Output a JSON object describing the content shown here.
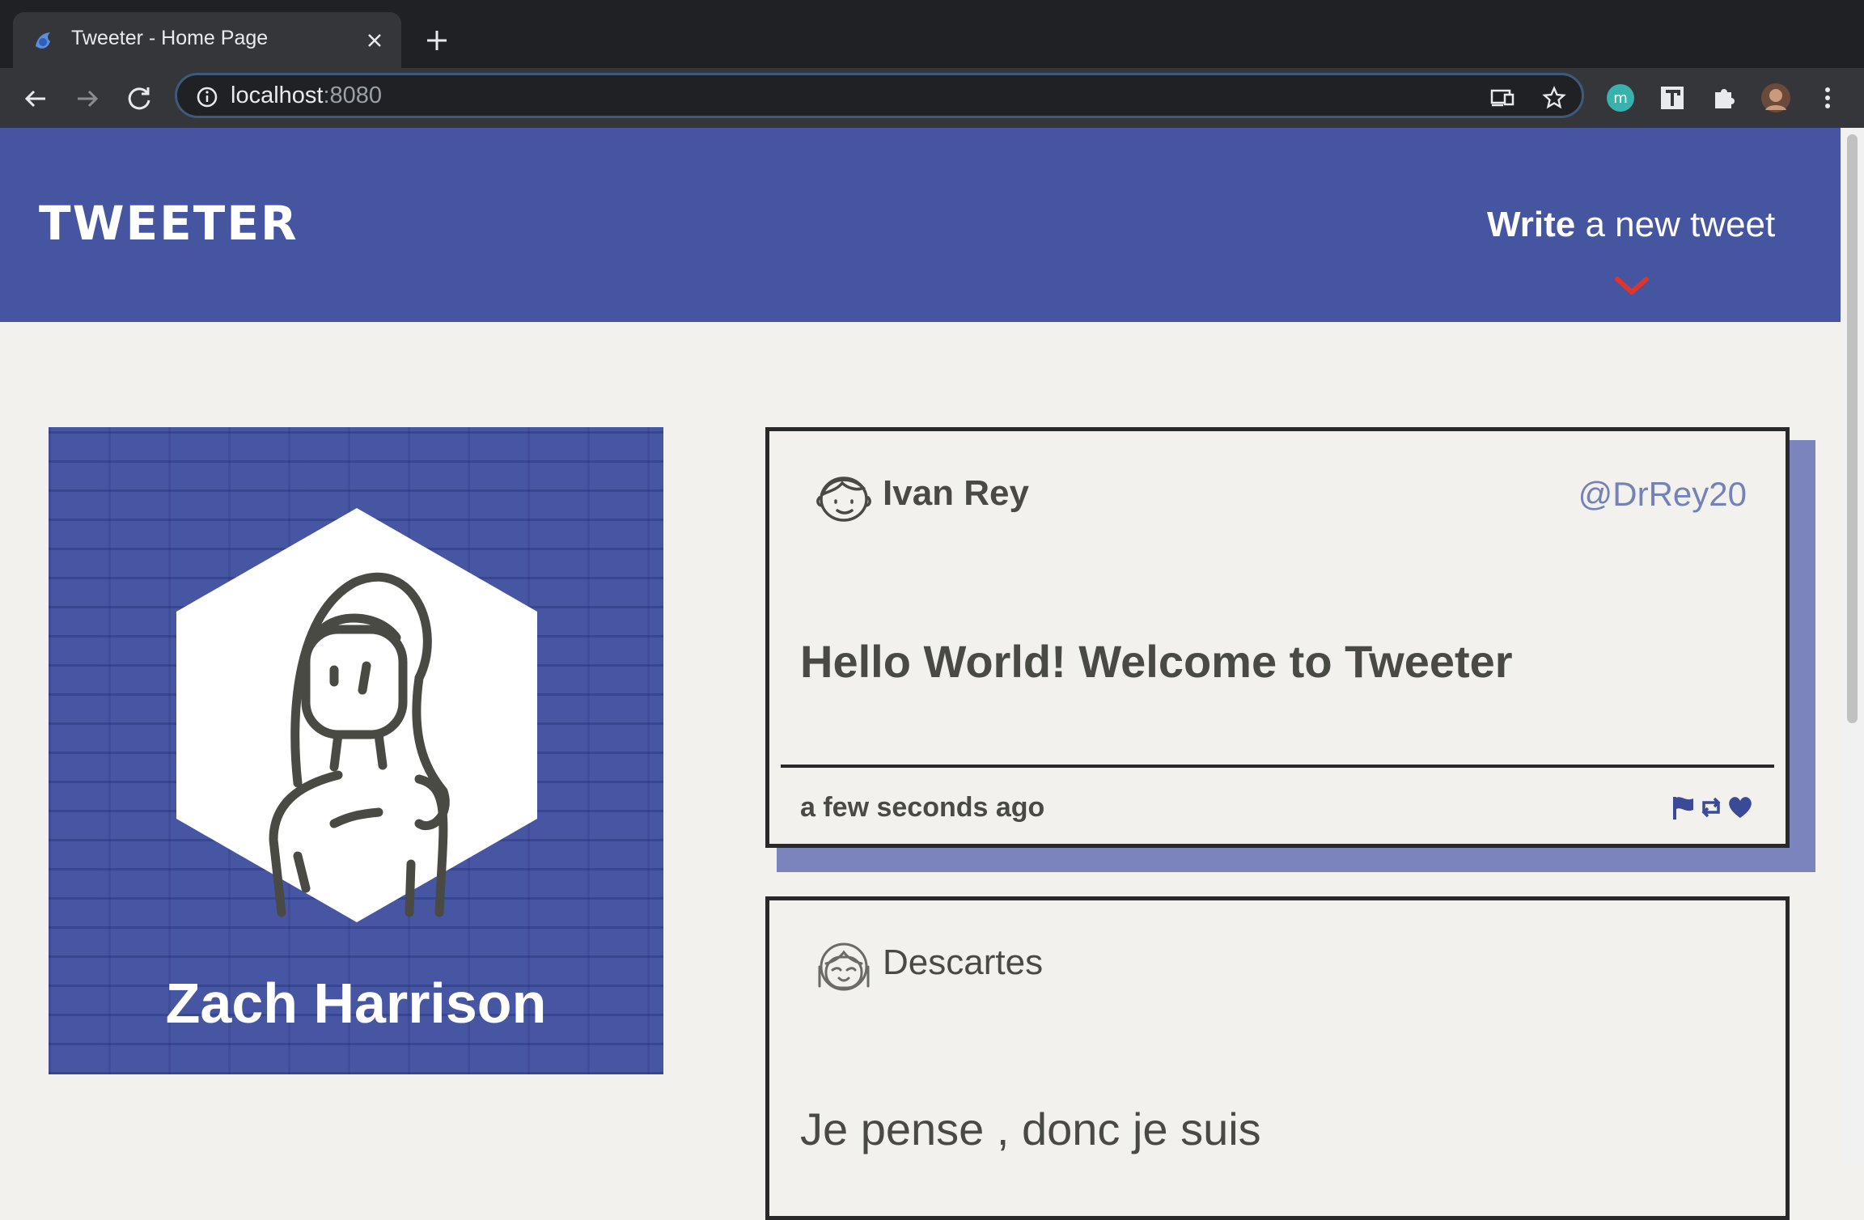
{
  "browser": {
    "tab_title": "Tweeter - Home Page",
    "url_host": "localhost",
    "url_port": ":8080",
    "icons": [
      "back-icon",
      "forward-icon",
      "reload-icon",
      "info-icon",
      "cast-icon",
      "star-icon",
      "extension-m-icon",
      "extension-t-icon",
      "puzzle-icon",
      "avatar",
      "menu-dots-icon"
    ]
  },
  "header": {
    "logo": "TWEETER",
    "compose_strong": "Write",
    "compose_rest": " a new tweet"
  },
  "profile": {
    "name": "Zach Harrison"
  },
  "tweets": [
    {
      "name": "Ivan Rey",
      "handle": "@DrRey20",
      "body": "Hello World! Welcome to Tweeter",
      "time": "a few seconds ago",
      "actions": [
        "flag-icon",
        "retweet-icon",
        "heart-icon"
      ]
    },
    {
      "name": "Descartes",
      "body": "Je pense , donc je suis"
    }
  ],
  "colors": {
    "brand": "#4655a0",
    "accent": "#e0352b",
    "text": "#4a4a44",
    "handle": "#7382b8",
    "background": "#f2f1ed"
  }
}
